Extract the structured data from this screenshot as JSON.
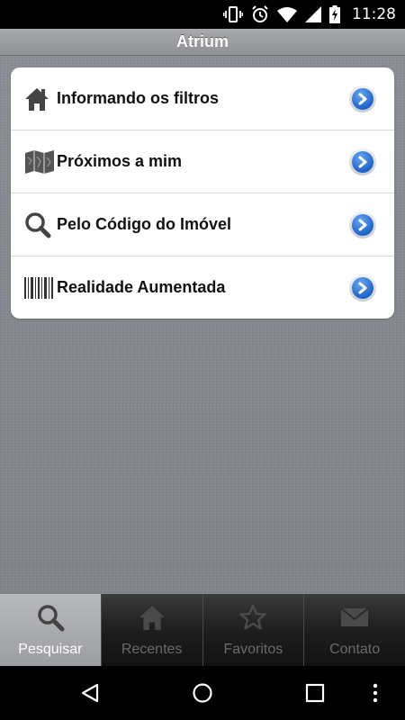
{
  "status_bar": {
    "time": "11:28",
    "icons": [
      "vibrate-icon",
      "alarm-icon",
      "wifi-icon",
      "signal-icon",
      "battery-charging-icon"
    ]
  },
  "header": {
    "title": "Atrium"
  },
  "menu": {
    "items": [
      {
        "label": "Informando os filtros",
        "icon": "house-icon"
      },
      {
        "label": "Próximos a mim",
        "icon": "map-icon"
      },
      {
        "label": "Pelo Código do Imóvel",
        "icon": "search-icon"
      },
      {
        "label": "Realidade Aumentada",
        "icon": "barcode-icon"
      }
    ]
  },
  "tabs": {
    "items": [
      {
        "label": "Pesquisar",
        "icon": "search-icon",
        "active": true
      },
      {
        "label": "Recentes",
        "icon": "house-icon",
        "active": false
      },
      {
        "label": "Favoritos",
        "icon": "star-icon",
        "active": false
      },
      {
        "label": "Contato",
        "icon": "envelope-icon",
        "active": false
      }
    ]
  },
  "nav_bar": {
    "buttons": [
      "back-icon",
      "home-icon",
      "recents-icon",
      "more-icon"
    ]
  },
  "colors": {
    "accent_blue": "#1f63c9",
    "title_bar": "#9a9ca0",
    "background_linen": "#85898f",
    "tab_active": "#b0b1b4",
    "tab_inactive": "#1e1e1e"
  }
}
